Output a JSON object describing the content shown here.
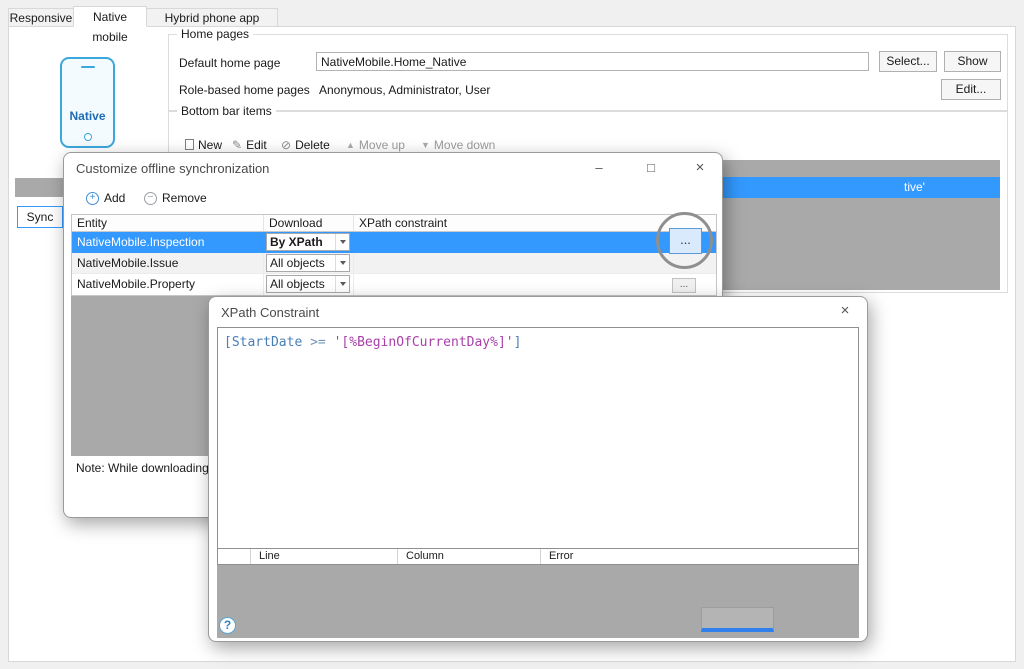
{
  "colors": {
    "selection_blue": "#3399ff",
    "accent_blue": "#2f80ed",
    "phone_blue": "#3aa7dd",
    "empty_area_gray": "#a9a9a9"
  },
  "tabs": [
    {
      "label": "Responsive"
    },
    {
      "label": "Native mobile"
    },
    {
      "label": "Hybrid phone app online"
    }
  ],
  "phone": {
    "label": "Native"
  },
  "home_pages": {
    "legend": "Home pages",
    "default_home_page_label": "Default home page",
    "default_home_page_value": "NativeMobile.Home_Native",
    "select_button": "Select...",
    "show_button": "Show",
    "role_based_label": "Role-based home pages",
    "role_based_value": "Anonymous, Administrator, User",
    "edit_button": "Edit..."
  },
  "bottom_bar_items": {
    "legend": "Bottom bar items",
    "toolbar": {
      "new": "New",
      "edit": "Edit",
      "delete": "Delete",
      "move_up": "Move up",
      "move_down": "Move down"
    },
    "selected_row_fragment": "tive'"
  },
  "sync_button": "Sync",
  "sync_dialog": {
    "title": "Customize offline synchronization",
    "add_button": "Add",
    "remove_button": "Remove",
    "columns": [
      "Entity",
      "Download",
      "XPath constraint"
    ],
    "rows": [
      {
        "entity": "NativeMobile.Inspection",
        "download": "By XPath"
      },
      {
        "entity": "NativeMobile.Issue",
        "download": "All objects"
      },
      {
        "entity": "NativeMobile.Property",
        "download": "All objects"
      }
    ],
    "ellipsis": "...",
    "note": "Note: While downloading o"
  },
  "xpath_dialog": {
    "title": "XPath Constraint",
    "code_tokens": [
      {
        "text": "[",
        "color": "#4a7fb5"
      },
      {
        "text": "StartDate",
        "color": "#4a7fb5"
      },
      {
        "text": " >= ",
        "color": "#7293b8"
      },
      {
        "text": "'[%BeginOfCurrentDay%]'",
        "color": "#a93fa9"
      },
      {
        "text": "]",
        "color": "#4a7fb5"
      }
    ],
    "error_columns": [
      "Line",
      "Column",
      "Error"
    ]
  },
  "icons": {
    "add": "+",
    "remove": "−",
    "edit": "✎",
    "delete": "⊘",
    "move_up": "▲",
    "move_down": "▼",
    "help": "?"
  },
  "window_controls": {
    "minimize": "–",
    "maximize": "□",
    "close": "×"
  }
}
